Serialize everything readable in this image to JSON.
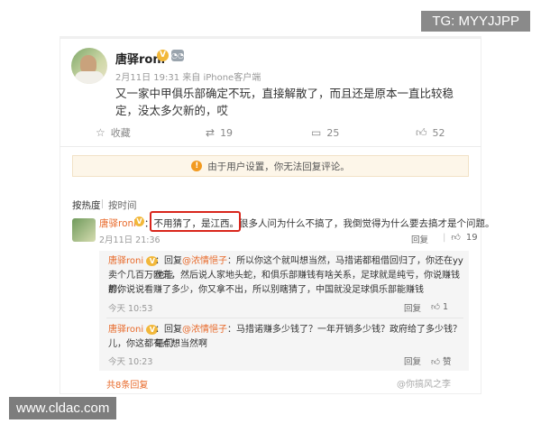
{
  "watermarks": {
    "top": "TG: MYYJJPP",
    "bottom": "www.cldac.com",
    "source": "@你搞风之李"
  },
  "post": {
    "author": "唐驿roni",
    "meta": "2月11日 19:31 来自 iPhone客户端",
    "text": "又一家中甲俱乐部确定不玩，直接解散了，而且还是原本一直比较稳定，没太多欠新的，哎"
  },
  "actions": {
    "fav_label": "收藏",
    "repost_count": "19",
    "comment_count": "25",
    "like_count": "52"
  },
  "notice": "由于用户设置，你无法回复评论。",
  "sort": {
    "hot": "按热度",
    "time": "按时间"
  },
  "comment": {
    "name": "唐驿roni",
    "highlight": "不用猜了，是江西。",
    "text_rest": "很多人问为什么不搞了，我倒觉得为什么要去搞才是个问题。",
    "date": "2月11日 21:36",
    "reply_label": "回复",
    "like_count": "19"
  },
  "replies": [
    {
      "name": "唐驿roni",
      "mention": "@浓情悒子",
      "lines": [
        "：回复                    ：所以你这个就叫想当然，马措诺都租借回归了，你还在yy他能",
        "卖个几百万欧元，然后说人家地头蛇，和俱乐部赚钱有啥关系，足球就是纯亏，你说赚钱的，",
        "那你说说看赚了多少，你又拿不出，所以别瞎猜了，中国就没足球俱乐部能赚钱"
      ],
      "time": "今天 10:53",
      "reply_label": "回复",
      "like_count": "1"
    },
    {
      "name": "唐驿roni",
      "mention": "@浓情悒子",
      "lines": [
        "：回复                    ：马措诺赚多少钱了？一年开销多少钱？政府给了多少钱？哥们",
        "儿，你这都有点想当然啊"
      ],
      "time": "今天 10:23",
      "reply_label": "回复",
      "like_label": "赞"
    }
  ],
  "more_replies": "共8条回复"
}
